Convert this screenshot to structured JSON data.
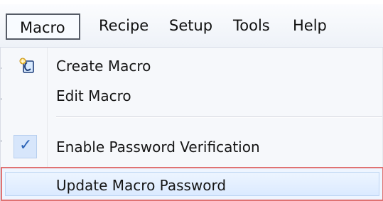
{
  "menubar": {
    "items": [
      {
        "label": "Macro"
      },
      {
        "label": "Recipe"
      },
      {
        "label": "Setup"
      },
      {
        "label": "Tools"
      },
      {
        "label": "Help"
      }
    ]
  },
  "dropdown": {
    "items": [
      {
        "label": "Create Macro",
        "icon": "create-macro-icon"
      },
      {
        "label": "Edit Macro"
      },
      {
        "label": "Enable Password Verification",
        "checked": true
      },
      {
        "label": "Update Macro Password",
        "highlighted": true
      }
    ]
  },
  "colors": {
    "menubar_bg": "#eef2f8",
    "dropdown_bg": "#f6f8fb",
    "highlight_border": "#e07272",
    "check": "#2f66b8"
  }
}
